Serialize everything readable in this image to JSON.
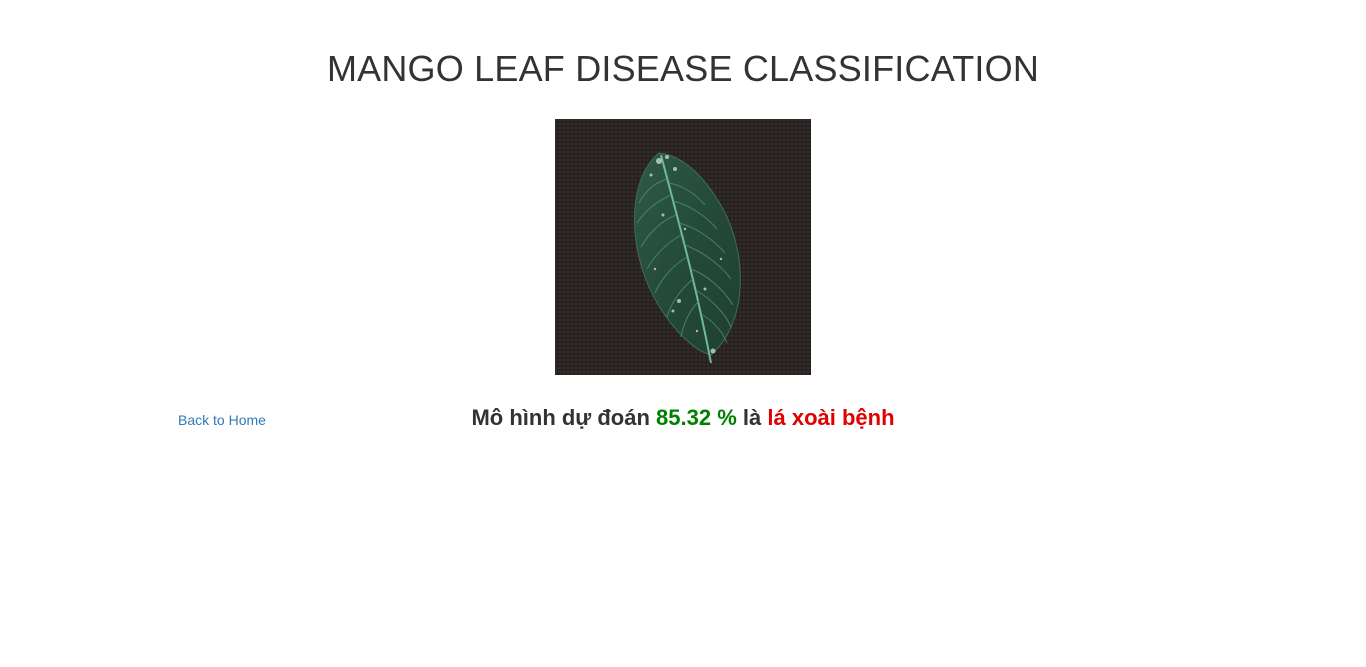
{
  "header": {
    "title": "MANGO LEAF DISEASE CLASSIFICATION"
  },
  "image": {
    "subject": "mango-leaf-photo"
  },
  "nav": {
    "back_label": "Back to Home"
  },
  "result": {
    "prefix": "Mô hình dự đoán",
    "percentage": "85.32 %",
    "connector": "là",
    "label": "lá xoài bệnh"
  },
  "colors": {
    "percentage": "#008000",
    "label": "#e00000",
    "link": "#337ab7"
  }
}
